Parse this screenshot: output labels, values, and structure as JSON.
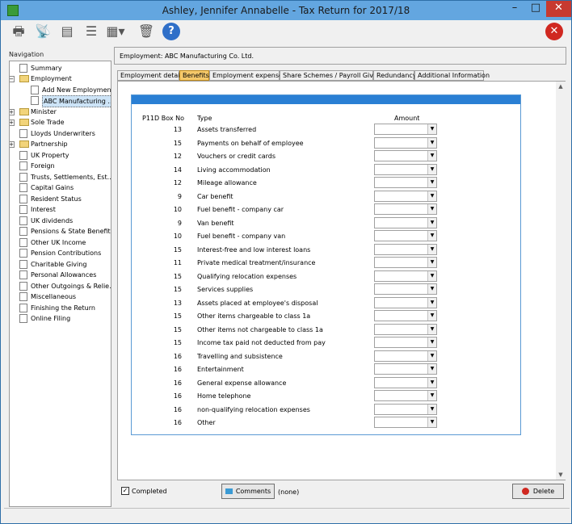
{
  "window": {
    "title": "Ashley, Jennifer Annabelle - Tax Return for 2017/18",
    "minimize": "–",
    "maximize": "□",
    "close": "✕"
  },
  "toolbar": {
    "icons": [
      "printer-icon",
      "broadcast-icon",
      "document-icon",
      "list-icon",
      "dropdown-list-icon",
      "trash-icon",
      "help-icon",
      "exit-icon"
    ]
  },
  "navigation": {
    "header": "Navigation",
    "items": [
      {
        "label": "Summary"
      },
      {
        "label": "Employment"
      },
      {
        "label": "Add New Employment"
      },
      {
        "label": "ABC Manufacturing ..."
      },
      {
        "label": "Minister"
      },
      {
        "label": "Sole Trade"
      },
      {
        "label": "Lloyds Underwriters"
      },
      {
        "label": "Partnership"
      },
      {
        "label": "UK Property"
      },
      {
        "label": "Foreign"
      },
      {
        "label": "Trusts, Settlements, Est..."
      },
      {
        "label": "Capital Gains"
      },
      {
        "label": "Resident Status"
      },
      {
        "label": "Interest"
      },
      {
        "label": "UK dividends"
      },
      {
        "label": "Pensions & State Benefits"
      },
      {
        "label": "Other UK Income"
      },
      {
        "label": "Pension Contributions"
      },
      {
        "label": "Charitable Giving"
      },
      {
        "label": "Personal Allowances"
      },
      {
        "label": "Other Outgoings & Relie..."
      },
      {
        "label": "Miscellaneous"
      },
      {
        "label": "Finishing the Return"
      },
      {
        "label": "Online Filing"
      }
    ]
  },
  "content": {
    "header": "Employment: ABC Manufacturing Co. Ltd.",
    "tabs": [
      {
        "label": "Employment details"
      },
      {
        "label": "Benefits"
      },
      {
        "label": "Employment expenses"
      },
      {
        "label": "Share Schemes / Payroll Giving"
      },
      {
        "label": "Redundancy"
      },
      {
        "label": "Additional Information"
      }
    ],
    "columns": {
      "box": "P11D Box No",
      "type": "Type",
      "amount": "Amount"
    },
    "rows": [
      {
        "box": "13",
        "type": "Assets transferred",
        "amount": ""
      },
      {
        "box": "15",
        "type": "Payments on behalf of employee",
        "amount": ""
      },
      {
        "box": "12",
        "type": "Vouchers or credit cards",
        "amount": ""
      },
      {
        "box": "14",
        "type": "Living accommodation",
        "amount": ""
      },
      {
        "box": "12",
        "type": "Mileage allowance",
        "amount": ""
      },
      {
        "box": "9",
        "type": "Car benefit",
        "amount": ""
      },
      {
        "box": "10",
        "type": "Fuel benefit - company car",
        "amount": ""
      },
      {
        "box": "9",
        "type": "Van benefit",
        "amount": ""
      },
      {
        "box": "10",
        "type": "Fuel benefit - company van",
        "amount": ""
      },
      {
        "box": "15",
        "type": "Interest-free and low interest loans",
        "amount": ""
      },
      {
        "box": "11",
        "type": "Private medical treatment/insurance",
        "amount": ""
      },
      {
        "box": "15",
        "type": "Qualifying relocation expenses",
        "amount": ""
      },
      {
        "box": "15",
        "type": "Services supplies",
        "amount": ""
      },
      {
        "box": "13",
        "type": "Assets placed at employee's disposal",
        "amount": ""
      },
      {
        "box": "15",
        "type": "Other items chargeable to class 1a",
        "amount": ""
      },
      {
        "box": "15",
        "type": "Other items not chargeable to class 1a",
        "amount": ""
      },
      {
        "box": "15",
        "type": "Income tax paid not deducted from pay",
        "amount": ""
      },
      {
        "box": "16",
        "type": "Travelling and subsistence",
        "amount": ""
      },
      {
        "box": "16",
        "type": "Entertainment",
        "amount": ""
      },
      {
        "box": "16",
        "type": "General expense allowance",
        "amount": ""
      },
      {
        "box": "16",
        "type": "Home telephone",
        "amount": ""
      },
      {
        "box": "16",
        "type": "non-qualifying relocation expenses",
        "amount": ""
      },
      {
        "box": "16",
        "type": "Other",
        "amount": ""
      }
    ]
  },
  "footer": {
    "completed_label": "Completed",
    "completed_checked": true,
    "comments_label": "Comments",
    "comments_value": "(none)",
    "delete_label": "Delete"
  }
}
